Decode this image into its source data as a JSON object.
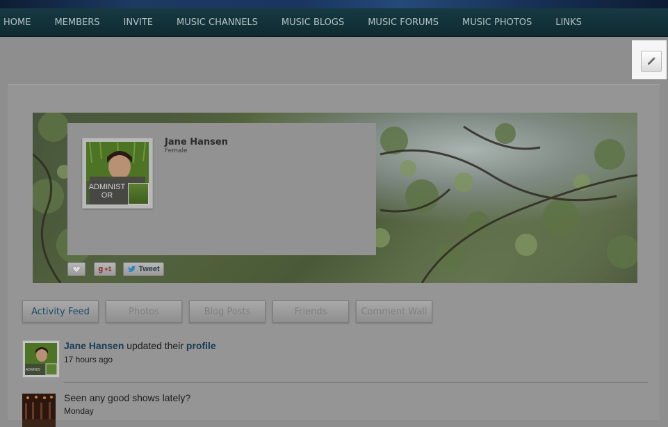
{
  "nav": {
    "items": [
      {
        "label": "HOME"
      },
      {
        "label": "MEMBERS"
      },
      {
        "label": "INVITE"
      },
      {
        "label": "MUSIC CHANNELS"
      },
      {
        "label": "MUSIC BLOGS"
      },
      {
        "label": "MUSIC FORUMS"
      },
      {
        "label": "MUSIC PHOTOS"
      },
      {
        "label": "LINKS"
      }
    ]
  },
  "edit": {
    "icon": "pencil-icon"
  },
  "profile": {
    "name": "Jane Hansen",
    "gender": "Female",
    "role_badge": "ADMINISTRATOR",
    "role_line1": "ADMINIST",
    "role_line2": "OR"
  },
  "social": {
    "gplus_label": "+1",
    "tweet_label": "Tweet"
  },
  "tabs": [
    {
      "label": "Activity Feed",
      "active": true
    },
    {
      "label": "Photos",
      "active": false
    },
    {
      "label": "Blog Posts",
      "active": false
    },
    {
      "label": "Friends",
      "active": false
    },
    {
      "label": "Comment Wall",
      "active": false
    }
  ],
  "feed": [
    {
      "user": "Jane Hansen",
      "action": " updated their ",
      "target": "profile",
      "time": "17 hours ago",
      "badge": "ADMINIS"
    },
    {
      "text": "Seen any good shows lately?",
      "time": "Monday"
    }
  ],
  "colors": {
    "nav_bg": "#173a43",
    "nav_text": "#b5c3c6",
    "link": "#163c54",
    "active_tab": "#1c4a66"
  }
}
